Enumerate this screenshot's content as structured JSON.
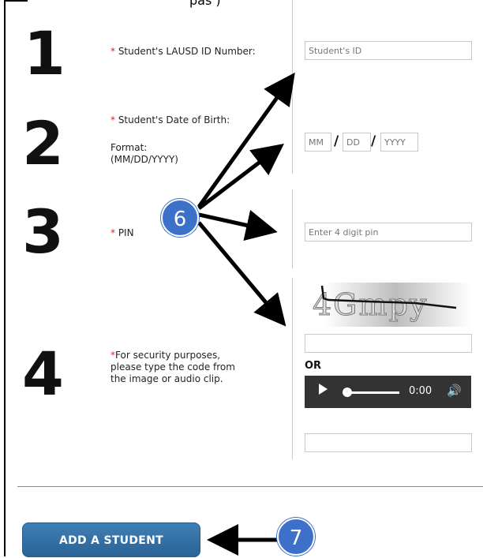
{
  "top_clipped_text": "pas ) ",
  "steps": {
    "one": "1",
    "two": "2",
    "three": "3",
    "four": "4"
  },
  "fields": {
    "student_id": {
      "label_req": "*",
      "label": " Student's LAUSD ID Number:",
      "placeholder": "Student's ID"
    },
    "dob": {
      "label_req": "*",
      "label": " Student's Date of Birth:",
      "format_label": "Format:",
      "format_value": "(MM/DD/YYYY)",
      "mm_placeholder": "MM",
      "dd_placeholder": "DD",
      "yyyy_placeholder": "YYYY",
      "separator": "/"
    },
    "pin": {
      "label_req": "*",
      "label": " PIN",
      "placeholder": "Enter 4 digit pin"
    },
    "security": {
      "label_req": "*",
      "label_line1": "For security purposes,",
      "label_line2": "please type the code from",
      "label_line3": "the image or audio clip.",
      "captcha_text": "4Gmpy",
      "or_label": "OR",
      "audio_time": "0:00"
    }
  },
  "submit_label": "ADD A STUDENT",
  "callouts": {
    "six": "6",
    "seven": "7"
  },
  "colors": {
    "required": "#e2231a",
    "button": "#2f6ea5",
    "badge": "#3d70c8"
  }
}
